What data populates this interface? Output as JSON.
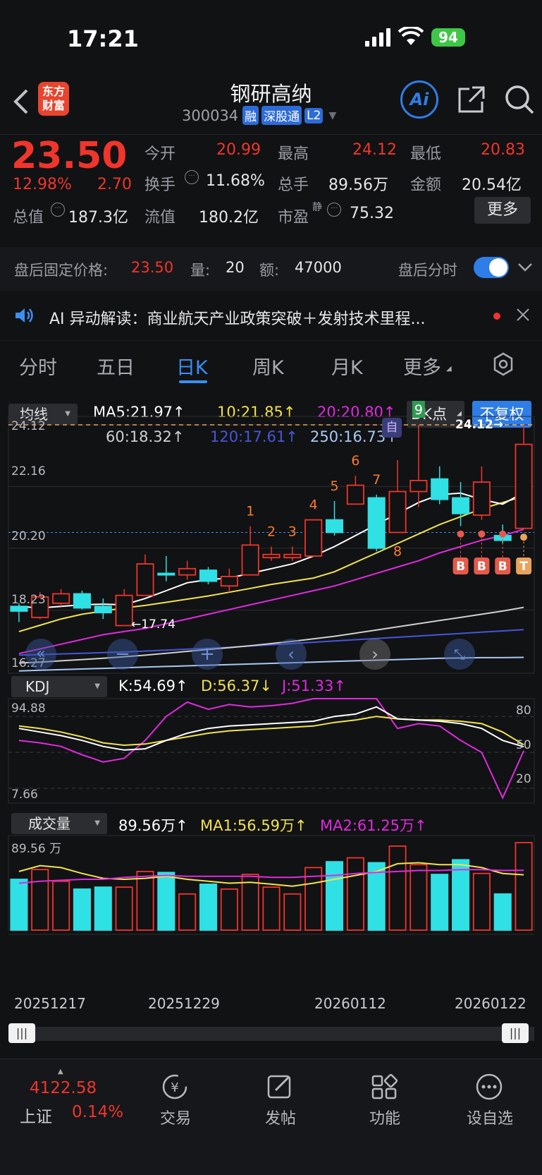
{
  "status": {
    "time": "17:21",
    "battery": "94"
  },
  "header": {
    "logo_line1": "东方",
    "logo_line2": "财富",
    "title": "钢研高纳",
    "code": "300034",
    "tags": [
      "融",
      "深股通",
      "L2"
    ],
    "ai_label": "Ai"
  },
  "quote": {
    "price": "23.50",
    "change_pct": "12.98%",
    "change_amt": "2.70",
    "open_label": "今开",
    "open": "20.99",
    "high_label": "最高",
    "high": "24.12",
    "low_label": "最低",
    "low": "20.83",
    "turnover_label": "换手",
    "turnover": "11.68%",
    "volume_label": "总手",
    "volume": "89.56万",
    "amount_label": "金额",
    "amount": "20.54亿",
    "mktcap_label": "总值",
    "mktcap": "187.3亿",
    "float_label": "流值",
    "float": "180.2亿",
    "pe_label": "市盈",
    "pe_sup": "静",
    "pe": "75.32",
    "more_button": "更多"
  },
  "afterhours": {
    "price_label": "盘后固定价格:",
    "price": "23.50",
    "qty_label": "量:",
    "qty": "20",
    "amt_label": "额:",
    "amt": "47000",
    "toggle_label": "盘后分时"
  },
  "ainews": {
    "text": "AI 异动解读：商业航天产业政策突破＋发射技术里程..."
  },
  "tabs": [
    "分时",
    "五日",
    "日K",
    "周K",
    "月K",
    "更多"
  ],
  "active_tab": "日K",
  "ma_bar": {
    "selector": "均线",
    "ma5": "MA5:21.97↑",
    "ma10": "10:21.85↑",
    "ma20": "20:20.80↑",
    "ma60": "60:18.32↑",
    "ma120": "120:17.61↑",
    "ma250": "250:16.73↑",
    "dk_button": "DK点",
    "adjust_button": "不复权"
  },
  "price_axis": {
    "top": "24.12",
    "mid": "22.16",
    "low": "20.20",
    "bottom1": "18.23",
    "bottom2": "16.27",
    "max_marker": "24.12→",
    "min_marker": "←17.74",
    "zi": "自"
  },
  "kdj": {
    "selector": "KDJ",
    "k": "K:54.69↑",
    "d": "D:56.37↓",
    "j": "J:51.33↑",
    "axis_top": "94.88",
    "axis_bottom": "7.66",
    "lvl80": "80",
    "lvl50": "50",
    "lvl20": "20"
  },
  "volume": {
    "selector": "成交量",
    "vol": "89.56万↑",
    "ma1": "MA1:56.59万↑",
    "ma2": "MA2:61.25万↑",
    "axis_top": "89.56 万"
  },
  "dates": [
    "20251217",
    "20251229",
    "20260112",
    "20260122"
  ],
  "bottom_nav": {
    "index_value": "4122.58",
    "index_name": "上证",
    "index_change": "0.14%",
    "items": [
      "交易",
      "发帖",
      "功能",
      "设自选"
    ]
  },
  "colors": {
    "up": "#f0352c",
    "down": "#2fe0e4",
    "accent": "#3b8ff2",
    "ma5": "#ffffff",
    "ma10": "#f3e34a",
    "ma20": "#e02adf",
    "ma60": "#cfcfcf",
    "ma120": "#4656d8",
    "ma250": "#a9c8f2"
  },
  "chart_data": {
    "type": "candlestick",
    "candles": [
      {
        "o": 18.35,
        "c": 18.2,
        "h": 18.45,
        "l": 17.85
      },
      {
        "o": 18.0,
        "c": 18.65,
        "h": 18.8,
        "l": 17.95
      },
      {
        "o": 18.45,
        "c": 18.75,
        "h": 18.9,
        "l": 18.35
      },
      {
        "o": 18.75,
        "c": 18.3,
        "h": 18.85,
        "l": 18.25
      },
      {
        "o": 18.35,
        "c": 18.15,
        "h": 18.6,
        "l": 17.95
      },
      {
        "o": 17.74,
        "c": 18.7,
        "h": 18.9,
        "l": 17.74
      },
      {
        "o": 18.7,
        "c": 19.7,
        "h": 20.0,
        "l": 18.7
      },
      {
        "o": 19.4,
        "c": 19.35,
        "h": 19.95,
        "l": 19.15
      },
      {
        "o": 19.35,
        "c": 19.55,
        "h": 19.8,
        "l": 19.2
      },
      {
        "o": 19.5,
        "c": 19.15,
        "h": 19.6,
        "l": 19.05
      },
      {
        "o": 19.0,
        "c": 19.3,
        "h": 19.55,
        "l": 18.8
      },
      {
        "o": 19.35,
        "c": 20.3,
        "h": 20.9,
        "l": 19.35
      },
      {
        "o": 19.9,
        "c": 20.0,
        "h": 20.25,
        "l": 19.8
      },
      {
        "o": 19.9,
        "c": 20.0,
        "h": 20.25,
        "l": 19.8
      },
      {
        "o": 19.95,
        "c": 21.1,
        "h": 21.1,
        "l": 19.95
      },
      {
        "o": 21.1,
        "c": 20.7,
        "h": 21.7,
        "l": 20.6
      },
      {
        "o": 21.6,
        "c": 22.2,
        "h": 22.5,
        "l": 21.6
      },
      {
        "o": 21.8,
        "c": 20.2,
        "h": 21.9,
        "l": 20.1
      },
      {
        "o": 20.7,
        "c": 22.0,
        "h": 23.0,
        "l": 20.7
      },
      {
        "o": 22.0,
        "c": 22.35,
        "h": 24.12,
        "l": 21.5
      },
      {
        "o": 22.4,
        "c": 21.75,
        "h": 22.8,
        "l": 21.6
      },
      {
        "o": 21.8,
        "c": 21.3,
        "h": 22.3,
        "l": 20.9
      },
      {
        "o": 21.25,
        "c": 22.3,
        "h": 22.8,
        "l": 21.1
      },
      {
        "o": 20.6,
        "c": 20.45,
        "h": 20.95,
        "l": 20.35
      },
      {
        "o": 20.83,
        "c": 23.5,
        "h": 24.12,
        "l": 20.83
      }
    ],
    "labels": [
      "",
      "",
      "",
      "",
      "",
      "",
      "",
      "",
      "",
      "",
      "",
      "1",
      "2",
      "3",
      "4",
      "5",
      "6",
      "7",
      "8",
      "9",
      "",
      "",
      "",
      "",
      ""
    ],
    "signals": [
      "",
      "",
      "",
      "",
      "",
      "",
      "",
      "",
      "",
      "",
      "",
      "",
      "",
      "",
      "",
      "",
      "",
      "",
      "",
      "",
      "",
      "B",
      "B",
      "B",
      "T"
    ],
    "ma5": [
      18.35,
      18.3,
      18.35,
      18.4,
      18.42,
      18.4,
      18.6,
      18.85,
      19.1,
      19.2,
      19.25,
      19.4,
      19.55,
      19.7,
      19.95,
      20.25,
      20.6,
      20.95,
      21.3,
      21.65,
      21.9,
      21.95,
      21.75,
      21.6,
      21.97
    ],
    "ma10": [
      17.55,
      17.75,
      17.95,
      18.1,
      18.2,
      18.3,
      18.38,
      18.48,
      18.58,
      18.68,
      18.8,
      18.92,
      19.05,
      19.15,
      19.25,
      19.45,
      19.75,
      20.05,
      20.35,
      20.65,
      20.95,
      21.2,
      21.45,
      21.65,
      21.85
    ],
    "ma20": [
      16.85,
      17.0,
      17.15,
      17.3,
      17.45,
      17.55,
      17.65,
      17.8,
      17.95,
      18.1,
      18.25,
      18.4,
      18.55,
      18.7,
      18.85,
      19.0,
      19.2,
      19.4,
      19.6,
      19.8,
      20.05,
      20.25,
      20.45,
      20.6,
      20.8
    ],
    "ma60": [
      16.55,
      16.58,
      16.62,
      16.66,
      16.7,
      16.75,
      16.8,
      16.86,
      16.92,
      16.98,
      17.04,
      17.1,
      17.17,
      17.24,
      17.32,
      17.4,
      17.5,
      17.6,
      17.7,
      17.8,
      17.9,
      18.0,
      18.1,
      18.2,
      18.32
    ],
    "ma120": [
      16.8,
      16.82,
      16.84,
      16.86,
      16.88,
      16.9,
      16.93,
      16.96,
      16.99,
      17.02,
      17.05,
      17.09,
      17.13,
      17.17,
      17.21,
      17.25,
      17.29,
      17.33,
      17.37,
      17.41,
      17.45,
      17.49,
      17.53,
      17.57,
      17.61
    ],
    "ma250": [
      16.3,
      16.32,
      16.34,
      16.36,
      16.38,
      16.4,
      16.42,
      16.44,
      16.46,
      16.48,
      16.5,
      16.52,
      16.54,
      16.56,
      16.58,
      16.6,
      16.62,
      16.64,
      16.66,
      16.68,
      16.7,
      16.71,
      16.72,
      16.72,
      16.73
    ],
    "kdj_k": [
      70,
      67,
      64,
      60,
      55,
      52,
      53,
      60,
      66,
      70,
      72,
      73,
      74,
      75,
      76,
      80,
      82,
      88,
      78,
      77,
      76,
      74,
      70,
      60,
      54.69
    ],
    "kdj_d": [
      72,
      70,
      67,
      63,
      58,
      56,
      57,
      60,
      63,
      66,
      68,
      69,
      70,
      71,
      72,
      75,
      77,
      80,
      78,
      77,
      77,
      76,
      74,
      67,
      56.37
    ],
    "kdj_j": [
      60,
      58,
      55,
      48,
      42,
      45,
      60,
      80,
      92,
      86,
      90,
      88,
      89,
      91,
      95,
      96,
      98,
      102,
      70,
      74,
      72,
      60,
      50,
      12,
      51.33
    ],
    "kdj_ylim": [
      7.66,
      94.88
    ],
    "volumes": [
      52,
      62,
      50,
      42,
      44,
      44,
      60,
      59,
      37,
      47,
      42,
      57,
      44,
      37,
      64,
      70,
      74,
      69,
      86,
      67,
      57,
      72,
      58,
      37,
      89.56
    ],
    "vol_ma1": [
      60,
      66,
      64,
      58,
      53,
      52,
      53,
      55,
      52,
      50,
      48,
      49,
      47,
      45,
      48,
      52,
      56,
      60,
      68,
      69,
      67,
      67,
      64,
      58,
      56.59
    ],
    "vol_ma2": [
      48,
      50,
      51,
      52,
      52,
      54,
      55,
      56,
      55,
      55,
      55,
      55,
      54,
      54,
      55,
      56,
      58,
      59,
      60,
      61,
      61,
      62,
      62,
      61,
      61.25
    ],
    "vol_max": 89.56,
    "ylim": [
      16.27,
      24.12
    ]
  }
}
